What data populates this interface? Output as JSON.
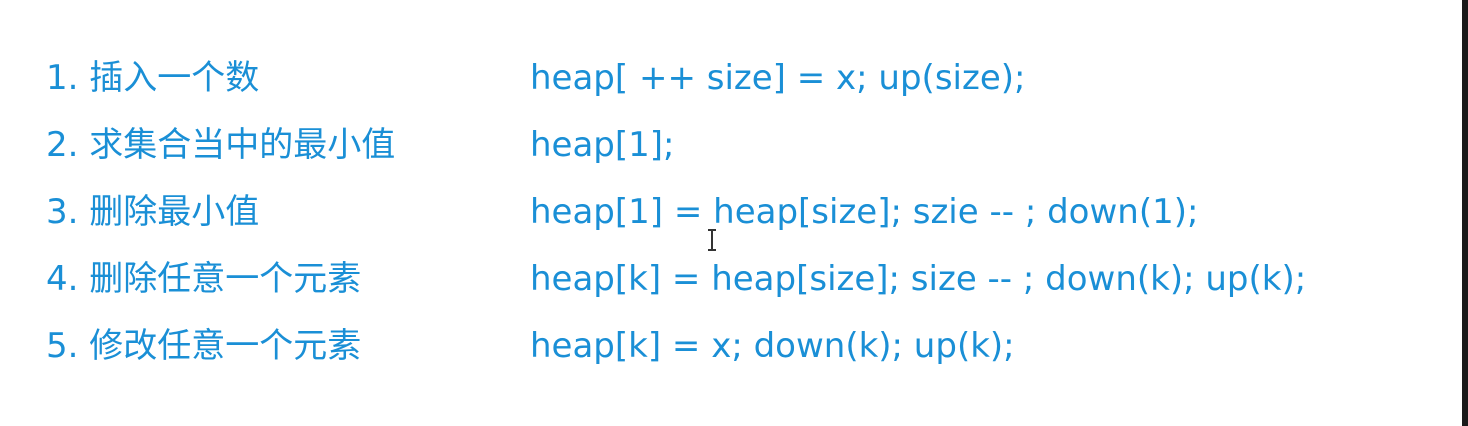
{
  "operations": [
    {
      "desc": "1. 插入一个数",
      "code": "heap[ ++ size] = x; up(size);"
    },
    {
      "desc": "2. 求集合当中的最小值",
      "code": "heap[1];"
    },
    {
      "desc": "3. 删除最小值",
      "code": "heap[1] = heap[size]; szie -- ; down(1);"
    },
    {
      "desc": "4. 删除任意一个元素",
      "code": "heap[k] = heap[size]; size -- ; down(k); up(k);"
    },
    {
      "desc": "5. 修改任意一个元素",
      "code": "heap[k] = x; down(k); up(k);"
    }
  ],
  "colors": {
    "text": "#1a8fd6",
    "background": "#ffffff",
    "cursor": "#333333"
  },
  "icons": {
    "cursor": "text-cursor-icon"
  }
}
